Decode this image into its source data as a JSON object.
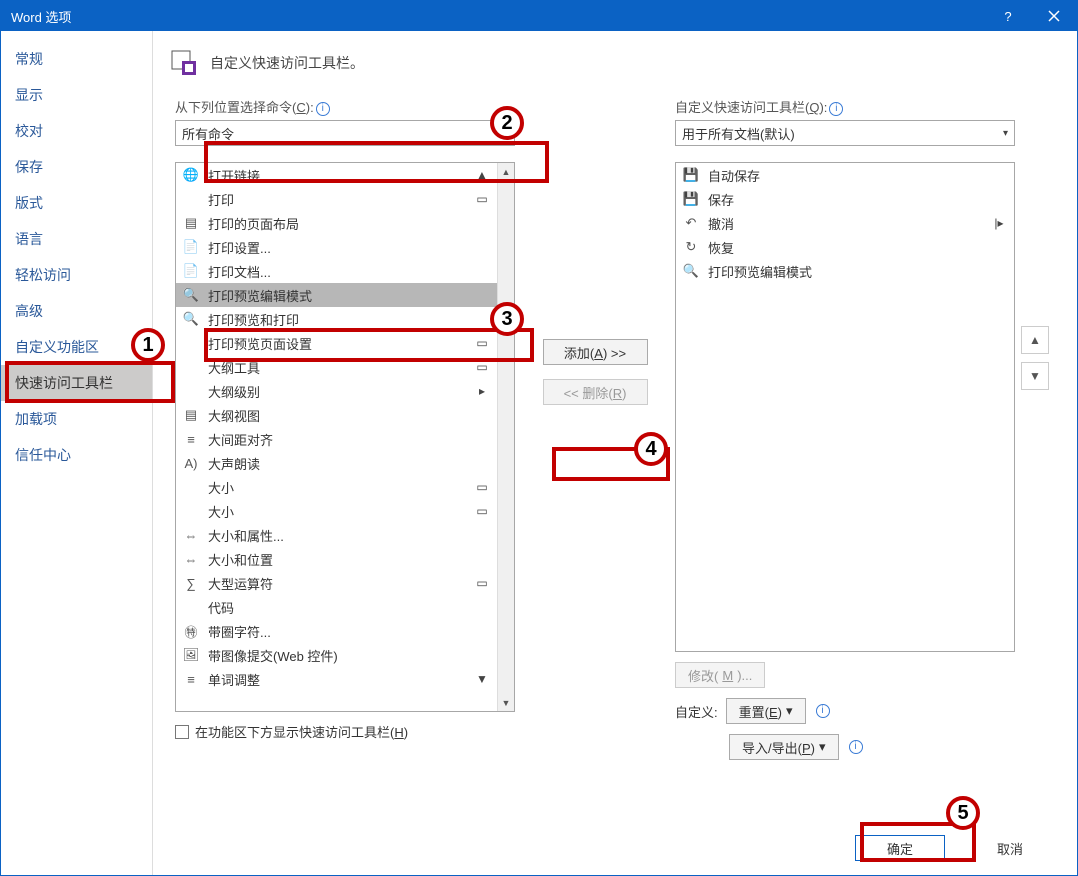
{
  "titlebar": {
    "title": "Word 选项"
  },
  "sidebar": {
    "items": [
      "常规",
      "显示",
      "校对",
      "保存",
      "版式",
      "语言",
      "轻松访问",
      "高级",
      "自定义功能区",
      "快速访问工具栏",
      "加载项",
      "信任中心"
    ],
    "selectedIndex": 9
  },
  "heading": "自定义快速访问工具栏。",
  "left": {
    "label_prefix": "从下列位置选择命令(",
    "label_hot": "C",
    "label_suffix": "):",
    "dropdown": "所有命令",
    "items": [
      {
        "icon": "🌐",
        "name": "打开链接",
        "r": "▲"
      },
      {
        "icon": "",
        "name": "打印",
        "r": "▭"
      },
      {
        "icon": "▤",
        "name": "打印的页面布局",
        "r": ""
      },
      {
        "icon": "📄",
        "name": "打印设置...",
        "r": ""
      },
      {
        "icon": "📄",
        "name": "打印文档...",
        "r": ""
      },
      {
        "icon": "🔍",
        "name": "打印预览编辑模式",
        "r": ""
      },
      {
        "icon": "🔍",
        "name": "打印预览和打印",
        "r": ""
      },
      {
        "icon": "",
        "name": "打印预览页面设置",
        "r": "▭"
      },
      {
        "icon": "",
        "name": "大纲工具",
        "r": "▭"
      },
      {
        "icon": "",
        "name": "大纲级别",
        "r": "▸"
      },
      {
        "icon": "▤",
        "name": "大纲视图",
        "r": ""
      },
      {
        "icon": "≡",
        "name": "大间距对齐",
        "r": ""
      },
      {
        "icon": "A)",
        "name": "大声朗读",
        "r": ""
      },
      {
        "icon": "",
        "name": "大小",
        "r": "▭"
      },
      {
        "icon": "",
        "name": "大小",
        "r": "▭"
      },
      {
        "icon": "⇔",
        "name": "大小和属性...",
        "r": ""
      },
      {
        "icon": "⇔",
        "name": "大小和位置",
        "r": ""
      },
      {
        "icon": "∑",
        "name": "大型运算符",
        "r": "▭"
      },
      {
        "icon": "",
        "name": "代码",
        "r": ""
      },
      {
        "icon": "㊕",
        "name": "带圈字符...",
        "r": ""
      },
      {
        "icon": "🖼",
        "name": "带图像提交(Web 控件)",
        "r": ""
      },
      {
        "icon": "≡",
        "name": "单词调整",
        "r": "▼"
      }
    ],
    "selectedIndex": 5
  },
  "right": {
    "label_prefix": "自定义快速访问工具栏(",
    "label_hot": "Q",
    "label_suffix": "):",
    "dropdown": "用于所有文档(默认)",
    "items": [
      {
        "icon": "💾",
        "name": "自动保存",
        "r": ""
      },
      {
        "icon": "💾",
        "name": "保存",
        "r": ""
      },
      {
        "icon": "↶",
        "name": "撤消",
        "r": "|▸"
      },
      {
        "icon": "↻",
        "name": "恢复",
        "r": ""
      },
      {
        "icon": "🔍",
        "name": "打印预览编辑模式",
        "r": ""
      }
    ]
  },
  "mid": {
    "add_prefix": "添加(",
    "add_hot": "A",
    "add_suffix": ") >>",
    "remove_prefix": "<< 删除(",
    "remove_hot": "R",
    "remove_suffix": ")"
  },
  "below": {
    "modify_prefix": "修改(",
    "modify_hot": "M",
    "modify_suffix": ")...",
    "customize_label": "自定义:",
    "reset_prefix": "重置(",
    "reset_hot": "E",
    "reset_suffix": ")",
    "import_prefix": "导入/导出(",
    "import_hot": "P",
    "import_suffix": ")"
  },
  "checkbox": {
    "label_prefix": "在功能区下方显示快速访问工具栏(",
    "label_hot": "H",
    "label_suffix": ")"
  },
  "footer": {
    "ok": "确定",
    "cancel": "取消"
  },
  "callouts": {
    "1": "1",
    "2": "2",
    "3": "3",
    "4": "4",
    "5": "5"
  }
}
